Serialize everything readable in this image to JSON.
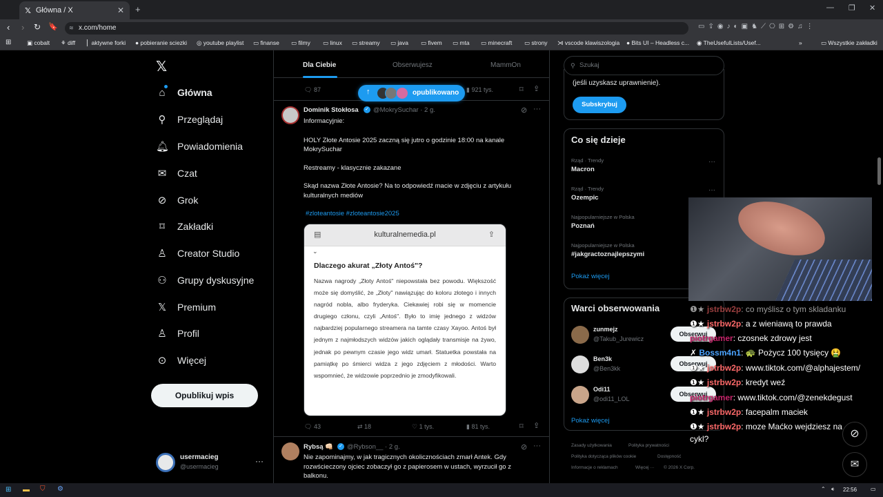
{
  "browser": {
    "tab_title": "Główna / X",
    "url": "x.com/home",
    "bookmarks": [
      "cobalt",
      "diff",
      "aktywne forki",
      "pobieranie sciezki",
      "youtube playlist",
      "finanse",
      "filmy",
      "linux",
      "streamy",
      "java",
      "fivem",
      "mta",
      "minecraft",
      "strony",
      "vscode klawiszologia",
      "Bits UI – Headless c...",
      "TheUsefulLists/Usef..."
    ],
    "all_bookmarks": "Wszystkie zakładki"
  },
  "nav": {
    "items": [
      "Główna",
      "Przeglądaj",
      "Powiadomienia",
      "Czat",
      "Grok",
      "Zakładki",
      "Creator Studio",
      "Grupy dyskusyjne",
      "Premium",
      "Profil",
      "Więcej"
    ],
    "post_button": "Opublikuj wpis",
    "user_name": "usermacieg",
    "user_handle": "@usermacieg"
  },
  "feed": {
    "tabs": [
      "Dla Ciebie",
      "Obserwujesz",
      "MammOn"
    ],
    "new_posts_pill": "opublikowano",
    "prev_post": {
      "replies": "87",
      "views": "921 tys."
    },
    "post1": {
      "name": "Dominik Stokłosa",
      "handle": "@MokrySuchar · 2 g.",
      "line1": "Informacyjnie:",
      "line2": "HOLY Złote Antosie 2025 zaczną się jutro o godzinie 18:00 na kanale MokrySuchar",
      "line3": "Restreamy - klasycznie zakazane",
      "line4": "Skąd nazwa Złote Antosie? Na to odpowiedź macie w zdjęciu z artykułu kulturalnych mediów",
      "hashtags": "#zloteantosie #zloteantosie2025",
      "card_site": "kulturalnemedia.pl",
      "card_title": "Dlaczego akurat „Złoty Antoś\"?",
      "card_body": "Nazwa nagrody „Złoty Antoś\" niepowstała bez powodu. Większość może się domyślić, że „Złoty\" nawiązując do koloru złotego i innych nagród nobla, albo fryderyka. Ciekawiej robi się w momencie drugiego członu, czyli „Antoś\". Było to imię jednego z widzów najbardziej popularnego streamera na tamte czasy Xayoo. Antoś był jednym z najmłodszych widzów jakich oglądały transmisje na żywo, jednak po pewnym czasie jego widz umarł. Statuetka powstała na pamiątkę po śmierci widza z jego zdjęciem z młodości. Warto wspomnieć, że widzowie poprzednio je zmodyfikowali.",
      "replies": "43",
      "reposts": "18",
      "likes": "1 tys.",
      "views": "81 tys."
    },
    "post2": {
      "name": "Rybsą 👊🏻",
      "handle": "@Rybson__ · 2 g.",
      "text": "Nie zapominajmy, w jak tragicznych okolicznościach zmarł Antek. Gdy rozwścieczony ojciec zobaczył go z papierosem w ustach, wyrzucił go z balkonu."
    }
  },
  "right": {
    "search_placeholder": "Szukaj",
    "premium_text": "(jeśli uzyskasz uprawnienie).",
    "subscribe": "Subskrybuj",
    "trends_title": "Co się dzieje",
    "trends": [
      {
        "context": "Rząd · Trendy",
        "topic": "Macron"
      },
      {
        "context": "Rząd · Trendy",
        "topic": "Ozempic"
      },
      {
        "context": "Najpopularniejsze w Polska",
        "topic": "Poznań"
      },
      {
        "context": "Najpopularniejsze w Polska",
        "topic": "#jakgractoznajlepszymi"
      }
    ],
    "show_more": "Pokaż więcej",
    "who_title": "Warci obserwowania",
    "who": [
      {
        "name": "zunmejz",
        "handle": "@Takub_Jurewicz"
      },
      {
        "name": "Ben3k",
        "handle": "@Ben3kk"
      },
      {
        "name": "Odi11",
        "handle": "@odi11_LOL"
      }
    ],
    "follow": "Obserwuj",
    "footer": [
      "Zasady użytkowania",
      "Polityka prywatności",
      "Polityka dotycząca plików cookie",
      "Dostępność",
      "Informacje o reklamach",
      "Więcej ···",
      "© 2026 X Corp."
    ]
  },
  "chat": [
    {
      "user": "jstrbw2p",
      "msg": "co myślisz o tym skladanku",
      "color": "#ff6a6a"
    },
    {
      "user": "jstrbw2p",
      "msg": "a z wieniawą to prawda",
      "color": "#ff6a6a"
    },
    {
      "user": "piotrgamer",
      "msg": "czosnek zdrowy jest",
      "color": "#c7246b"
    },
    {
      "user": "Bossm4n1",
      "msg": "🐢 Pożycz 100 tysięcy 🤮",
      "color": "#4aa3ff"
    },
    {
      "user": "jstrbw2p",
      "msg": "www.tiktok.com/@alphajestem/",
      "color": "#ff6a6a"
    },
    {
      "user": "jstrbw2p",
      "msg": "kredyt weź",
      "color": "#ff6a6a"
    },
    {
      "user": "piotrgamer",
      "msg": "www.tiktok.com/@zenekdegust",
      "color": "#c7246b"
    },
    {
      "user": "jstrbw2p",
      "msg": "facepalm maciek",
      "color": "#ff6a6a"
    },
    {
      "user": "jstrbw2p",
      "msg": "moze Maćko wejdziesz na",
      "color": "#ff6a6a"
    },
    {
      "user": "",
      "msg": "cykl?",
      "color": "#ff6a6a"
    }
  ],
  "taskbar": {
    "time": "22:56"
  }
}
